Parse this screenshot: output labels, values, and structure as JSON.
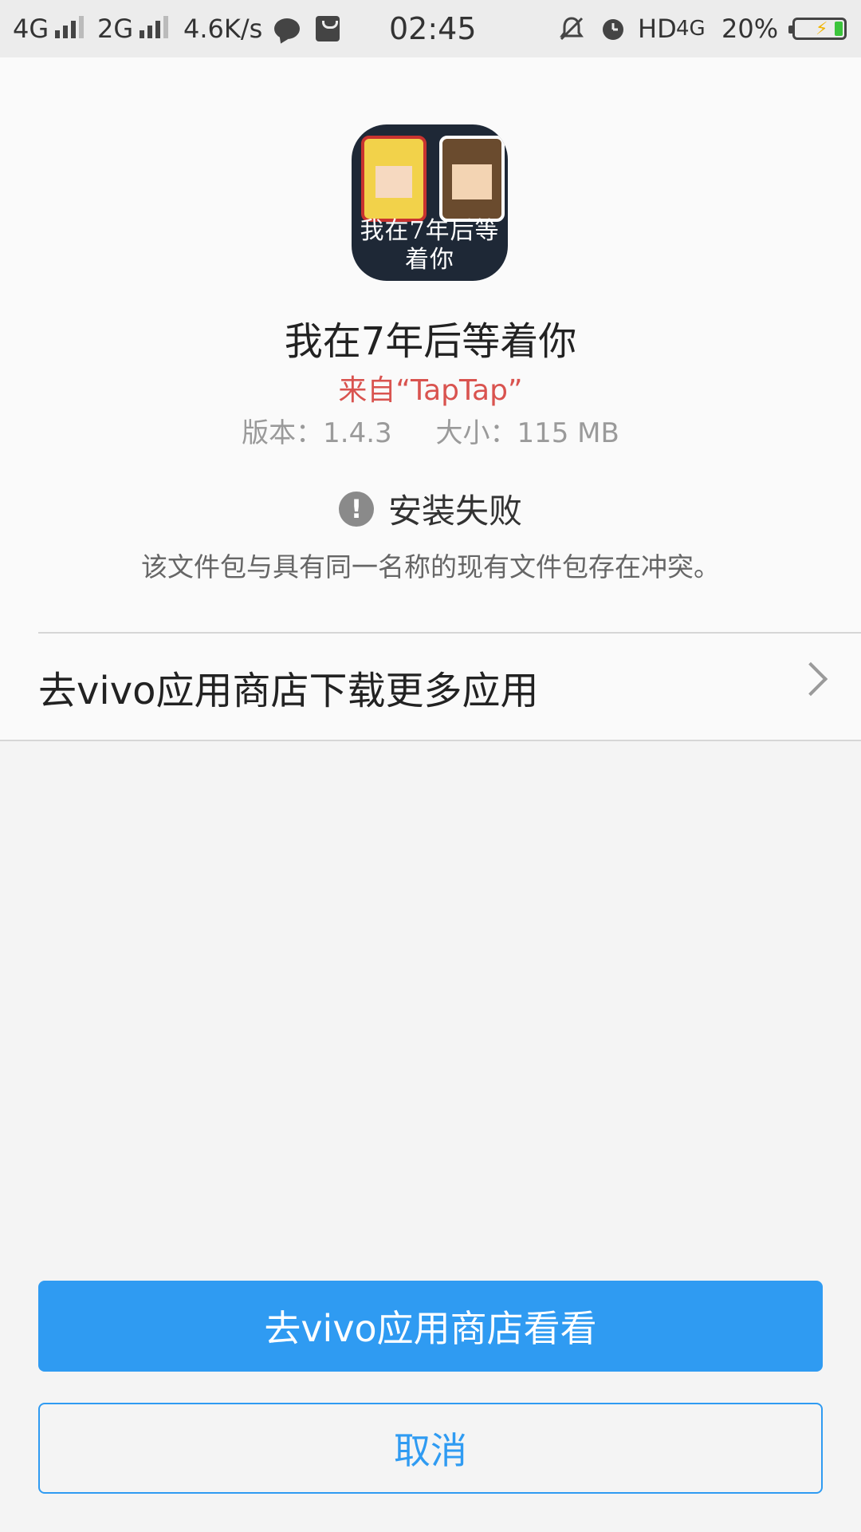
{
  "status_bar": {
    "network1": "4G",
    "network2": "2G",
    "speed": "4.6K/s",
    "time": "02:45",
    "hd": "HD",
    "network3": "4G",
    "battery": "20%",
    "icons": [
      "signal-icon",
      "chat-icon",
      "bag-icon",
      "bell-off-icon",
      "alarm-icon",
      "battery-icon"
    ]
  },
  "app": {
    "icon_text": "我在7年后等着你",
    "title": "我在7年后等着你",
    "source": "来自“TapTap”",
    "version": "版本：1.4.3",
    "size": "大小：115 MB"
  },
  "install": {
    "status": "安装失败",
    "message": "该文件包与具有同一名称的现有文件包存在冲突。"
  },
  "store_link": {
    "label": "去vivo应用商店下载更多应用"
  },
  "buttons": {
    "primary": "去vivo应用商店看看",
    "cancel": "取消"
  },
  "colors": {
    "accent": "#2f9bf2",
    "source_red": "#d9534f"
  }
}
